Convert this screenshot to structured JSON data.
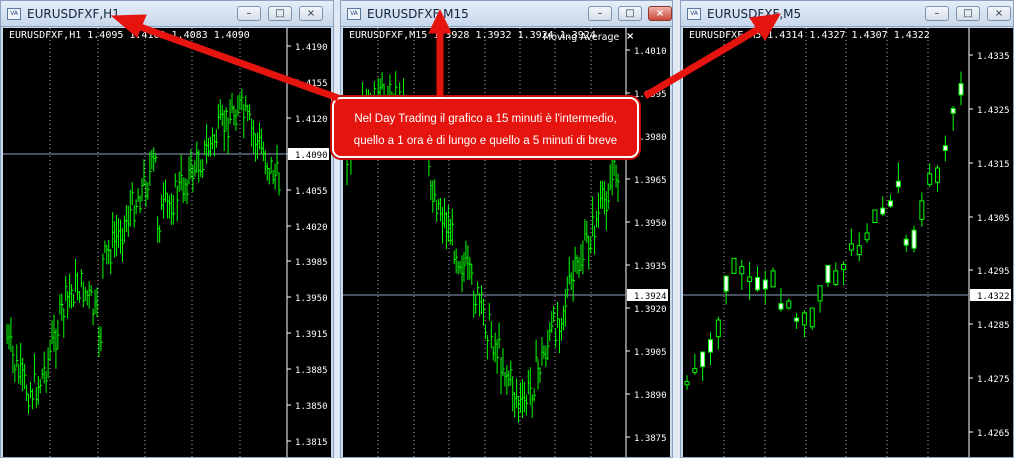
{
  "windows": [
    {
      "id": "h1",
      "title": "EURUSDFXF,H1",
      "info": "EURUSDFXF,H1  1.4095 1.4103 1.4083 1.4090",
      "price_labels": [
        "1.4190",
        "1.4155",
        "1.4120",
        "1.4090",
        "1.4055",
        "1.4020",
        "1.3985",
        "1.3950",
        "1.3915",
        "1.3885",
        "1.3850",
        "1.3815"
      ],
      "current_price": "1.4090",
      "has_close": false
    },
    {
      "id": "m15",
      "title": "EURUSDFXF,M15",
      "info": "EURUSDFXF,M15  1.3928 1.3932 1.3924 1.3924",
      "indicator": "Moving Average",
      "indicator_close": "×",
      "price_labels": [
        "1.4010",
        "1.3995",
        "1.3980",
        "1.3965",
        "1.3950",
        "1.3935",
        "1.3920",
        "1.3905",
        "1.3890",
        "1.3875"
      ],
      "current_price": "1.3924",
      "has_close": true
    },
    {
      "id": "m5",
      "title": "EURUSDFXF,M5",
      "info": "EURUSDFXF,M5  1.4314 1.4327 1.4307 1.4322",
      "price_labels": [
        "1.4335",
        "1.4325",
        "1.4315",
        "1.4305",
        "1.4295",
        "1.4285",
        "1.4275",
        "1.4265"
      ],
      "current_price": "1.4322",
      "has_close": false
    }
  ],
  "window_controls": {
    "minimize": "–",
    "maximize": "□",
    "close": "×"
  },
  "callout": {
    "line1": "Nel Day Trading il grafico a 15 minuti è l'intermedio,",
    "line2": "quello a 1 ora è di lungo e quello a 5 minuti di breve"
  },
  "colors": {
    "price_line": "#00ff00",
    "candle_down": "#ffffff",
    "callout_bg": "#e5140f",
    "arrow": "#e5140f"
  }
}
